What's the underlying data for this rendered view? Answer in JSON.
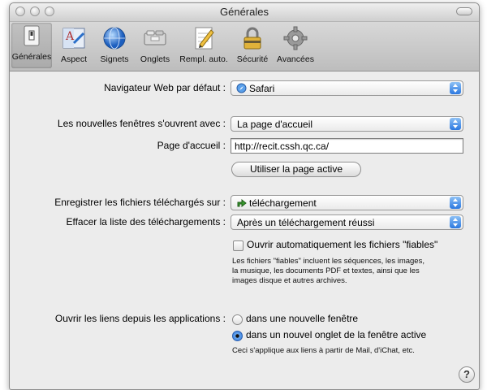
{
  "window": {
    "title": "Générales"
  },
  "toolbar": {
    "items": [
      {
        "label": "Générales",
        "icon": "light-switch-icon"
      },
      {
        "label": "Aspect",
        "icon": "font-aspect-icon"
      },
      {
        "label": "Signets",
        "icon": "globe-icon"
      },
      {
        "label": "Onglets",
        "icon": "tabs-icon"
      },
      {
        "label": "Rempl. auto.",
        "icon": "pencil-form-icon"
      },
      {
        "label": "Sécurité",
        "icon": "lock-icon"
      },
      {
        "label": "Avancées",
        "icon": "gear-icon"
      }
    ],
    "selected": "Générales"
  },
  "prefs": {
    "default_browser": {
      "label": "Navigateur Web par défaut :",
      "value": "Safari"
    },
    "new_windows": {
      "label": "Les nouvelles fenêtres s'ouvrent avec :",
      "value": "La page d'accueil"
    },
    "homepage": {
      "label": "Page d'accueil :",
      "value": "http://recit.cssh.qc.ca/"
    },
    "use_current_page": "Utiliser la page active",
    "download_to": {
      "label": "Enregistrer les fichiers téléchargés sur :",
      "value": "téléchargement"
    },
    "clear_downloads": {
      "label": "Effacer la liste des téléchargements :",
      "value": "Après un téléchargement réussi"
    },
    "open_safe": {
      "label": "Ouvrir automatiquement les fichiers \"fiables\"",
      "checked": false
    },
    "safe_note": [
      "Les fichiers \"fiables\" incluent les séquences, les images,",
      "la musique, les documents PDF et textes, ainsi que les",
      "images disque et autres archives."
    ],
    "open_links": {
      "label": "Ouvrir les liens depuis les applications :",
      "options": [
        "dans une nouvelle fenêtre",
        "dans un nouvel onglet de la fenêtre active"
      ],
      "selected": 1,
      "note": "Ceci s'applique aux liens à partir de Mail, d'iChat, etc."
    },
    "help": "?"
  },
  "colors": {
    "accent": "#2a78e0",
    "window_bg": "#ececec"
  }
}
